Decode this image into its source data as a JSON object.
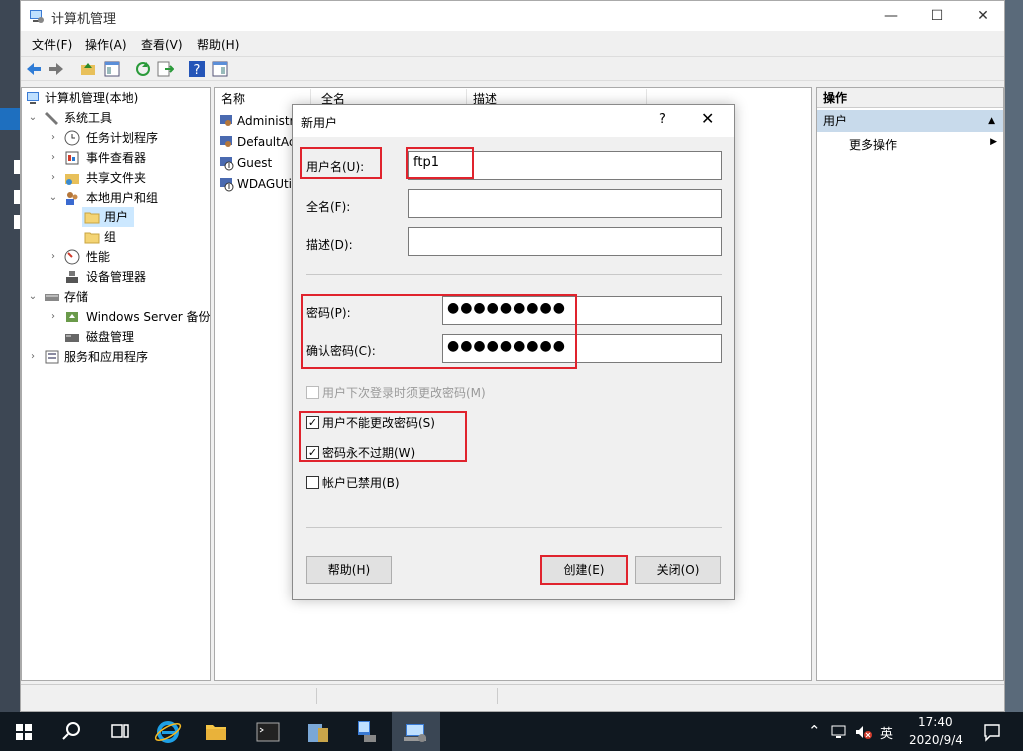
{
  "window": {
    "title": "计算机管理",
    "min": "—",
    "max": "☐",
    "close": "✕"
  },
  "menubar": [
    "文件(F)",
    "操作(A)",
    "查看(V)",
    "帮助(H)"
  ],
  "tree": {
    "root": "计算机管理(本地)",
    "system_tools": "系统工具",
    "task_scheduler": "任务计划程序",
    "event_viewer": "事件查看器",
    "shared_folders": "共享文件夹",
    "local_users": "本地用户和组",
    "users": "用户",
    "groups": "组",
    "performance": "性能",
    "device_manager": "设备管理器",
    "storage": "存储",
    "wsb": "Windows Server 备份",
    "disk_mgmt": "磁盘管理",
    "services": "服务和应用程序"
  },
  "list": {
    "headers": [
      "名称",
      "全名",
      "描述"
    ],
    "rows": [
      "Administrat",
      "DefaultAc",
      "Guest",
      "WDAGUti"
    ]
  },
  "actions": {
    "header": "操作",
    "section": "用户",
    "more": "更多操作"
  },
  "dialog": {
    "title": "新用户",
    "help": "?",
    "close": "✕",
    "username_label": "用户名(U):",
    "username_value": "ftp1",
    "fullname_label": "全名(F):",
    "fullname_value": "",
    "desc_label": "描述(D):",
    "desc_value": "",
    "pw_label": "密码(P):",
    "pw_value": "●●●●●●●●●",
    "pw2_label": "确认密码(C):",
    "pw2_value": "●●●●●●●●●",
    "cb_must_change": "用户下次登录时须更改密码(M)",
    "cb_cannot_change": "用户不能更改密码(S)",
    "cb_never_expires": "密码永不过期(W)",
    "cb_disabled": "帐户已禁用(B)",
    "checks": {
      "must_change": false,
      "cannot_change": true,
      "never_expires": true,
      "disabled": false
    },
    "check_mark": "✓",
    "btn_help": "帮助(H)",
    "btn_create": "创建(E)",
    "btn_close": "关闭(O)"
  },
  "taskbar": {
    "time": "17:40",
    "date": "2020/9/4",
    "ime": "英"
  },
  "colors": {
    "highlight": "#e0232d",
    "selected_bg": "#cce8ff",
    "action_section": "#c8daeb"
  }
}
